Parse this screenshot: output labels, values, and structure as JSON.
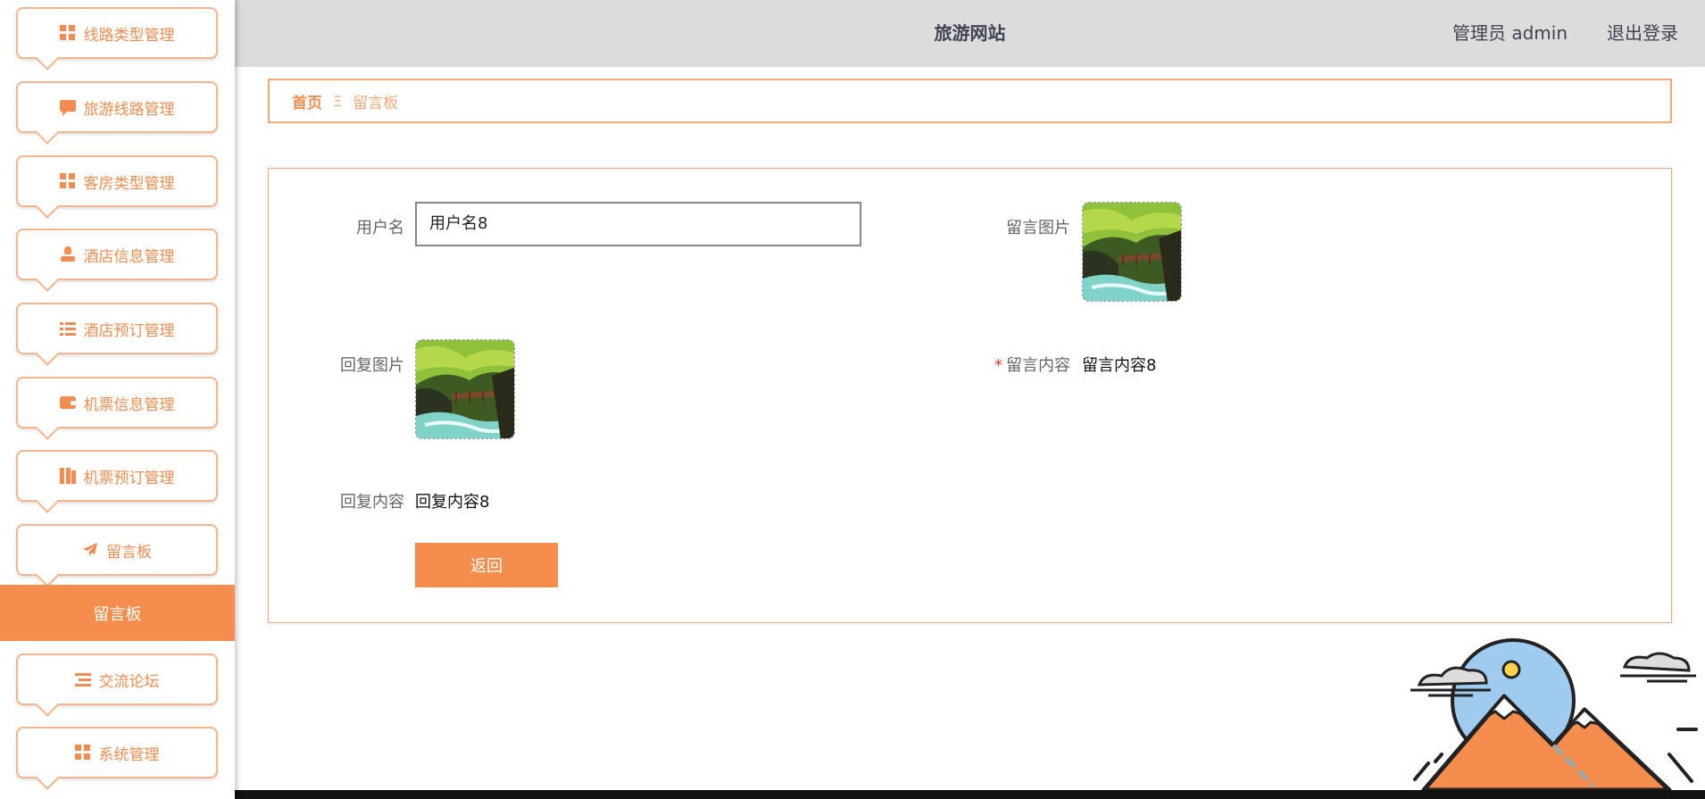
{
  "header": {
    "title": "旅游网站",
    "admin_info": "管理员 admin",
    "logout": "退出登录"
  },
  "sidebar": {
    "items": [
      {
        "label": "线路类型管理",
        "icon": "grid-icon"
      },
      {
        "label": "旅游线路管理",
        "icon": "chat-icon"
      },
      {
        "label": "客房类型管理",
        "icon": "grid-icon"
      },
      {
        "label": "酒店信息管理",
        "icon": "user-icon"
      },
      {
        "label": "酒店预订管理",
        "icon": "list-icon"
      },
      {
        "label": "机票信息管理",
        "icon": "wallet-icon"
      },
      {
        "label": "机票预订管理",
        "icon": "book-icon"
      },
      {
        "label": "留言板",
        "icon": "paper-plane-icon"
      }
    ],
    "active_item": "留言板",
    "items_after": [
      {
        "label": "交流论坛",
        "icon": "list-icon"
      },
      {
        "label": "系统管理",
        "icon": "grid-icon"
      }
    ]
  },
  "breadcrumb": {
    "home": "首页",
    "separator": "Ξ",
    "current": "留言板"
  },
  "form": {
    "username_label": "用户名",
    "username_value": "用户名8",
    "message_image_label": "留言图片",
    "reply_image_label": "回复图片",
    "message_content_label": "留言内容",
    "message_content_value": "留言内容8",
    "reply_content_label": "回复内容",
    "reply_content_value": "回复内容8",
    "required_mark": "*",
    "back_button": "返回"
  },
  "colors": {
    "accent": "#f48d4e",
    "header_bg": "#dcdcdc"
  }
}
